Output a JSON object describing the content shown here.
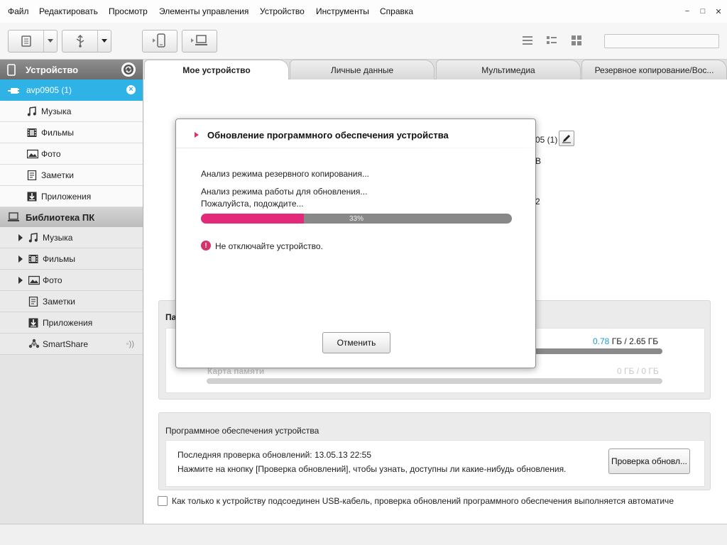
{
  "menu": [
    "Файл",
    "Редактировать",
    "Просмотр",
    "Элементы управления",
    "Устройство",
    "Инструменты",
    "Справка"
  ],
  "window_controls": [
    "−",
    "□",
    "✕"
  ],
  "search": {
    "placeholder": ""
  },
  "sidebar": {
    "device_header": "Устройство",
    "device_name": "avp0905 (1)",
    "device_items": [
      "Музыка",
      "Фильмы",
      "Фото",
      "Заметки",
      "Приложения"
    ],
    "library_header": "Библиотека ПК",
    "library_items": [
      "Музыка",
      "Фильмы",
      "Фото",
      "Заметки",
      "Приложения",
      "SmartShare"
    ]
  },
  "tabs": [
    "Мое устройство",
    "Личные данные",
    "Мультимедиа",
    "Резервное копирование/Вос..."
  ],
  "device_info": {
    "name_fragment": "05 (1)",
    "frag_2": "В",
    "frag_3": "2"
  },
  "memory": {
    "title_fragment": "Па",
    "used": "0.78",
    "total": " ГБ / 2.65 ГБ",
    "card_label": "Карта памяти",
    "card_usage": "0 ГБ / 0 ГБ"
  },
  "software": {
    "title": "Программное обеспечения устройства",
    "last_check": "Последняя проверка обновлений: 13.05.13 22:55",
    "hint": "Нажмите на кнопку [Проверка обновлений], чтобы узнать, доступны ли какие-нибудь обновления.",
    "check_button": "Проверка обновл..."
  },
  "auto_check_label": "Как только к устройству подсоединен USB-кабель, проверка обновлений программного обеспечения выполняется автоматиче",
  "dialog": {
    "title": "Обновление программного обеспечения устройства",
    "line1": "Анализ режима резервного копирования...",
    "line2": "Анализ режима работы для обновления...",
    "line3": "Пожалуйста, подождите...",
    "progress_label": "33%",
    "progress_value": 0.33,
    "warning": "Не отключайте устройство.",
    "cancel_button": "Отменить"
  },
  "colors": {
    "accent_blue": "#2fb2e6",
    "progress_pink": "#e5297a",
    "used_blue": "#1a9bd7"
  }
}
